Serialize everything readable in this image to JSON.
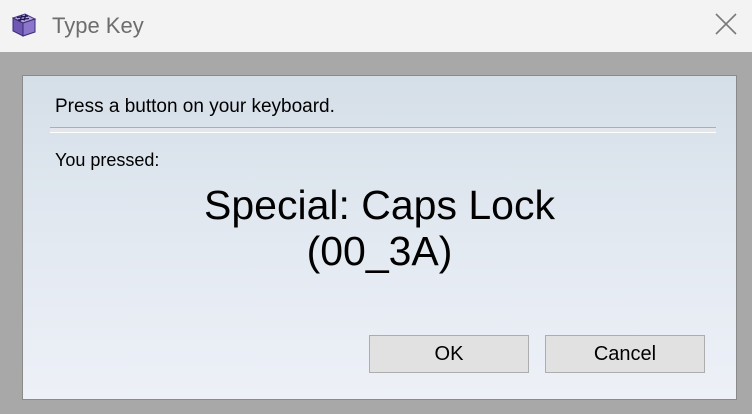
{
  "window": {
    "title": "Type Key",
    "app_icon": "keyboard-key-icon",
    "close_icon": "close-icon"
  },
  "dialog": {
    "instruction": "Press a button on your keyboard.",
    "pressed_label": "You pressed:",
    "key_name": "Special: Caps Lock",
    "key_code": "(00_3A)"
  },
  "buttons": {
    "ok_label": "OK",
    "cancel_label": "Cancel"
  },
  "colors": {
    "titlebar": "#f3f3f3",
    "title_text": "#6d6d6d",
    "frame": "#a8a8a8",
    "button_face": "#e1e1e1",
    "button_border": "#adadad"
  }
}
